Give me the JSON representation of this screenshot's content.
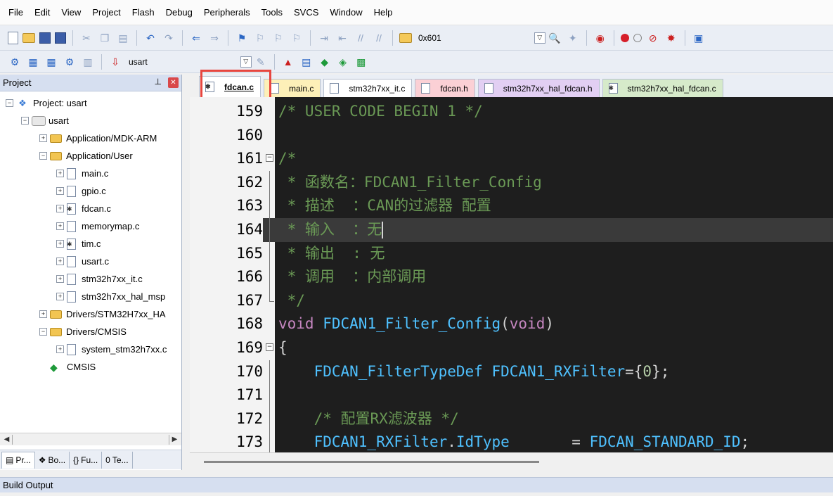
{
  "menu": [
    "File",
    "Edit",
    "View",
    "Project",
    "Flash",
    "Debug",
    "Peripherals",
    "Tools",
    "SVCS",
    "Window",
    "Help"
  ],
  "toolbar1": {
    "address_field": "0x601"
  },
  "toolbar2": {
    "target_select": "usart"
  },
  "project_panel": {
    "title": "Project",
    "tree": [
      {
        "label": "Project: usart",
        "kind": "project",
        "exp": "−",
        "indent": 0
      },
      {
        "label": "usart",
        "kind": "target",
        "exp": "−",
        "indent": 1
      },
      {
        "label": "Application/MDK-ARM",
        "kind": "folder",
        "exp": "+",
        "indent": 2
      },
      {
        "label": "Application/User",
        "kind": "folder",
        "exp": "−",
        "indent": 2
      },
      {
        "label": "main.c",
        "kind": "file",
        "exp": "+",
        "indent": 3
      },
      {
        "label": "gpio.c",
        "kind": "file",
        "exp": "+",
        "indent": 3
      },
      {
        "label": "fdcan.c",
        "kind": "file-gear",
        "exp": "+",
        "indent": 3
      },
      {
        "label": "memorymap.c",
        "kind": "file",
        "exp": "+",
        "indent": 3
      },
      {
        "label": "tim.c",
        "kind": "file-gear",
        "exp": "+",
        "indent": 3
      },
      {
        "label": "usart.c",
        "kind": "file",
        "exp": "+",
        "indent": 3
      },
      {
        "label": "stm32h7xx_it.c",
        "kind": "file",
        "exp": "+",
        "indent": 3
      },
      {
        "label": "stm32h7xx_hal_msp",
        "kind": "file",
        "exp": "+",
        "indent": 3
      },
      {
        "label": "Drivers/STM32H7xx_HA",
        "kind": "folder",
        "exp": "+",
        "indent": 2
      },
      {
        "label": "Drivers/CMSIS",
        "kind": "folder",
        "exp": "−",
        "indent": 2
      },
      {
        "label": "system_stm32h7xx.c",
        "kind": "file",
        "exp": "+",
        "indent": 3
      },
      {
        "label": "CMSIS",
        "kind": "diamond",
        "exp": "",
        "indent": 2
      }
    ],
    "tabs": [
      "Pr...",
      "Bo...",
      "Fu...",
      "Te..."
    ]
  },
  "editor_tabs": [
    {
      "label": "fdcan.c",
      "style": "active",
      "icon": "gear"
    },
    {
      "label": "main.c",
      "style": "main",
      "icon": "plain"
    },
    {
      "label": "stm32h7xx_it.c",
      "style": "it",
      "icon": "plain"
    },
    {
      "label": "fdcan.h",
      "style": "fh",
      "icon": "plain"
    },
    {
      "label": "stm32h7xx_hal_fdcan.h",
      "style": "halh",
      "icon": "plain"
    },
    {
      "label": "stm32h7xx_hal_fdcan.c",
      "style": "halc",
      "icon": "gear"
    }
  ],
  "code": {
    "current_line": 164,
    "lines": [
      {
        "n": "159",
        "fold": "",
        "parts": [
          [
            "comment",
            "/* USER CODE BEGIN 1 */"
          ]
        ]
      },
      {
        "n": "160",
        "fold": "",
        "parts": []
      },
      {
        "n": "161",
        "fold": "box",
        "parts": [
          [
            "comment",
            "/*"
          ]
        ]
      },
      {
        "n": "162",
        "fold": "line",
        "parts": [
          [
            "comment",
            " * 函数名：FDCAN1_Filter_Config"
          ]
        ]
      },
      {
        "n": "163",
        "fold": "line",
        "parts": [
          [
            "comment",
            " * 描述  ：CAN的过滤器 配置"
          ]
        ]
      },
      {
        "n": "164",
        "fold": "line",
        "parts": [
          [
            "comment",
            " * 输入  ：无"
          ]
        ],
        "cursor": true
      },
      {
        "n": "165",
        "fold": "line",
        "parts": [
          [
            "comment",
            " * 输出  : 无"
          ]
        ]
      },
      {
        "n": "166",
        "fold": "line",
        "parts": [
          [
            "comment",
            " * 调用  ：内部调用"
          ]
        ]
      },
      {
        "n": "167",
        "fold": "end",
        "parts": [
          [
            "comment",
            " */"
          ]
        ]
      },
      {
        "n": "168",
        "fold": "",
        "parts": [
          [
            "kw",
            "void"
          ],
          [
            "plain",
            " "
          ],
          [
            "func",
            "FDCAN1_Filter_Config"
          ],
          [
            "plain",
            "("
          ],
          [
            "kw",
            "void"
          ],
          [
            "plain",
            ")"
          ]
        ]
      },
      {
        "n": "169",
        "fold": "box",
        "parts": [
          [
            "plain",
            "{"
          ]
        ]
      },
      {
        "n": "170",
        "fold": "line",
        "parts": [
          [
            "plain",
            "    "
          ],
          [
            "type",
            "FDCAN_FilterTypeDef"
          ],
          [
            "plain",
            " "
          ],
          [
            "type",
            "FDCAN1_RXFilter"
          ],
          [
            "plain",
            "={"
          ],
          [
            "num",
            "0"
          ],
          [
            "plain",
            "};"
          ]
        ]
      },
      {
        "n": "171",
        "fold": "line",
        "parts": []
      },
      {
        "n": "172",
        "fold": "line",
        "parts": [
          [
            "plain",
            "    "
          ],
          [
            "comment",
            "/* 配置RX滤波器 */"
          ]
        ]
      },
      {
        "n": "173",
        "fold": "line",
        "parts": [
          [
            "plain",
            "    "
          ],
          [
            "type",
            "FDCAN1_RXFilter"
          ],
          [
            "plain",
            "."
          ],
          [
            "type",
            "IdType"
          ],
          [
            "plain",
            "       = "
          ],
          [
            "type",
            "FDCAN_STANDARD_ID"
          ],
          [
            "plain",
            ";"
          ]
        ]
      }
    ]
  },
  "build_output": {
    "title": "Build Output"
  }
}
